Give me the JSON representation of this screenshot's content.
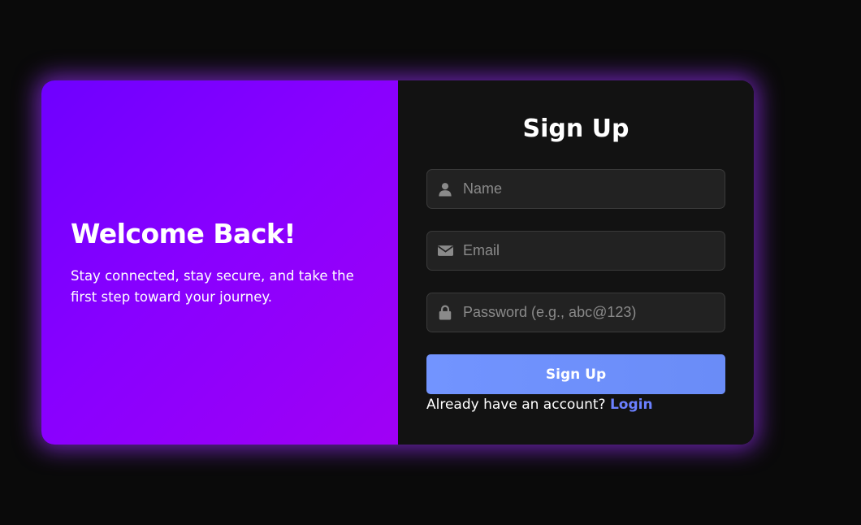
{
  "welcome": {
    "title": "Welcome Back!",
    "text": "Stay connected, stay secure, and take the first step toward your journey."
  },
  "form": {
    "title": "Sign Up",
    "fields": {
      "name": {
        "placeholder": "Name",
        "value": "",
        "icon": "user-icon"
      },
      "email": {
        "placeholder": "Email",
        "value": "",
        "icon": "envelope-icon"
      },
      "password": {
        "placeholder": "Password (e.g., abc@123)",
        "value": "",
        "icon": "lock-icon"
      }
    },
    "submit_label": "Sign Up",
    "login_prompt": "Already have an account?",
    "login_link": "Login"
  },
  "colors": {
    "background": "#0a0a0a",
    "gradient_start": "#6e00ff",
    "gradient_end": "#a000f5",
    "form_panel": "#121212",
    "button": "#7294ff",
    "link": "#6b80ff",
    "glow": "#8a2be2"
  }
}
